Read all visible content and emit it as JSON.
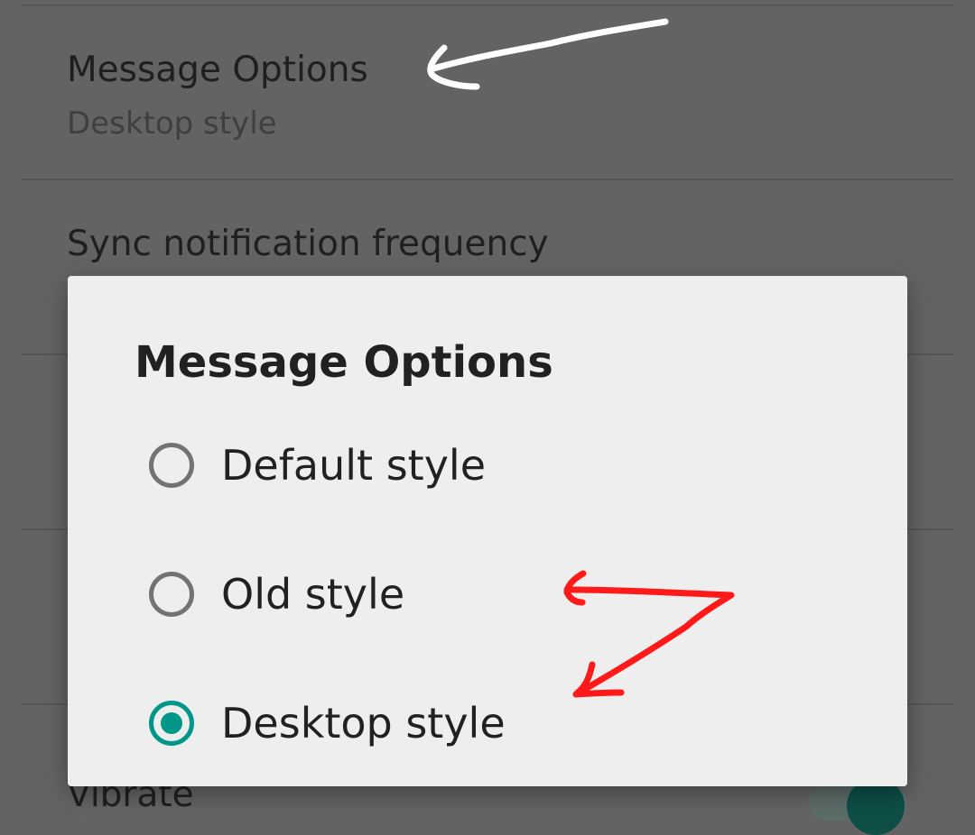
{
  "settings": {
    "items": [
      {
        "title": "Message Options",
        "summary": "Desktop style"
      },
      {
        "title": "Sync notification frequency",
        "summary": ""
      },
      {
        "title": "Vibrate",
        "summary": ""
      }
    ]
  },
  "dialog": {
    "title": "Message Options",
    "options": [
      {
        "label": "Default style",
        "checked": false
      },
      {
        "label": "Old style",
        "checked": false
      },
      {
        "label": "Desktop style",
        "checked": true
      }
    ]
  },
  "colors": {
    "accent": "#009688",
    "annotation_white": "#ffffff",
    "annotation_red": "#ff1a1a"
  }
}
